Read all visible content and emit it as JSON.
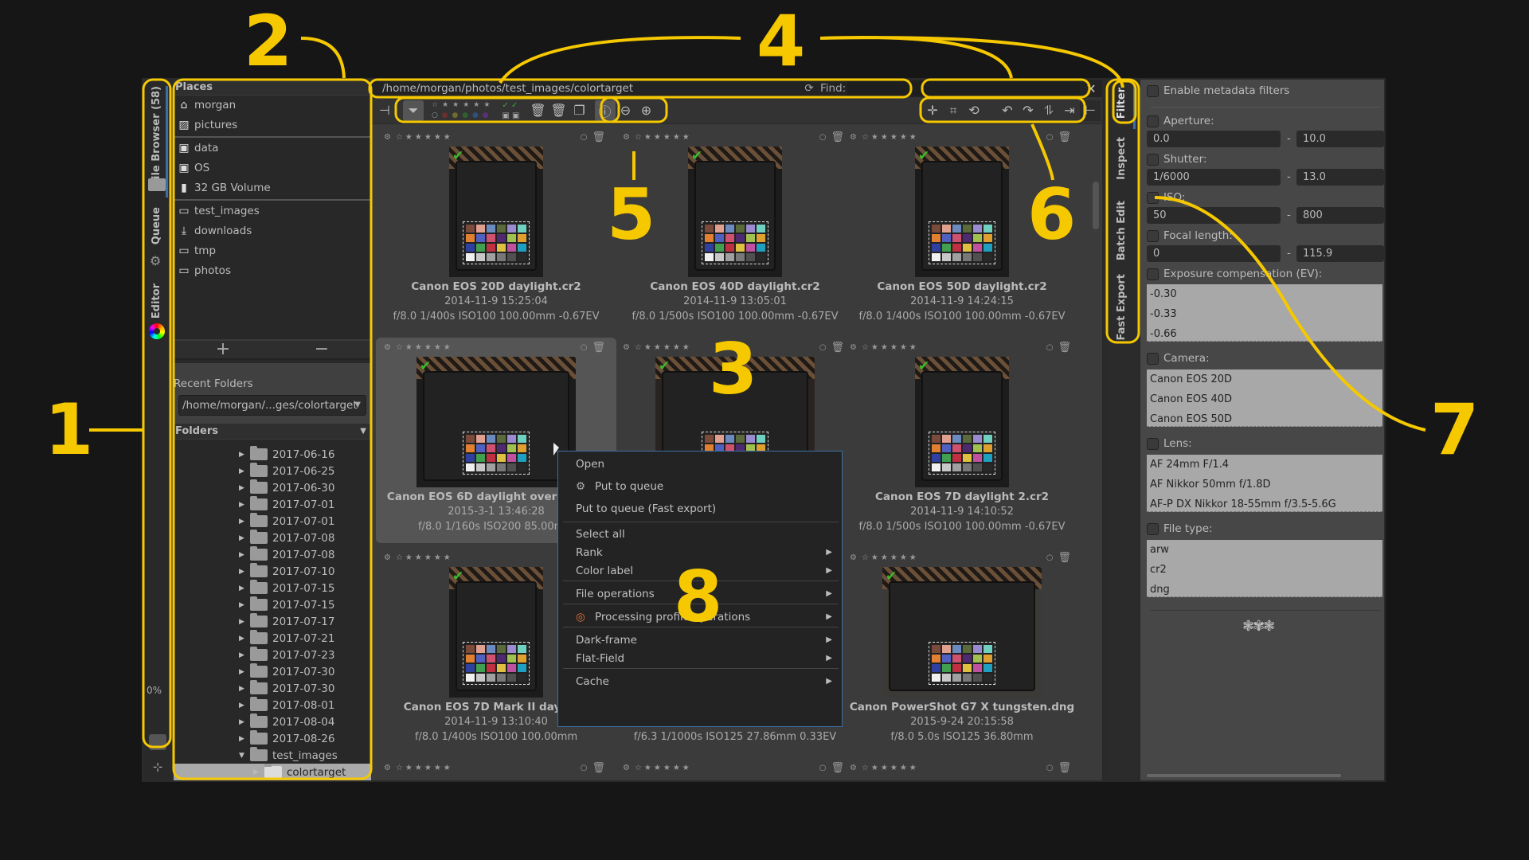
{
  "left_tabs": {
    "file_browser": "File Browser (58)",
    "queue": "Queue",
    "editor": "Editor",
    "progress": "0%"
  },
  "places": {
    "header": "Places",
    "items": [
      {
        "label": "morgan",
        "icon": "home-icon"
      },
      {
        "label": "pictures",
        "icon": "image-icon"
      },
      {
        "label": "data",
        "icon": "drive-icon"
      },
      {
        "label": "OS",
        "icon": "drive-icon"
      },
      {
        "label": "32 GB Volume",
        "icon": "usb-icon"
      },
      {
        "label": "test_images",
        "icon": "folder-icon"
      },
      {
        "label": "downloads",
        "icon": "download-icon"
      },
      {
        "label": "tmp",
        "icon": "folder-icon"
      },
      {
        "label": "photos",
        "icon": "folder-icon"
      }
    ],
    "add_label": "+",
    "remove_label": "−",
    "recent_header": "Recent Folders",
    "recent_value": "/home/morgan/...ges/colortarget",
    "folders_header": "Folders",
    "folders": [
      "2017-06-16",
      "2017-06-25",
      "2017-06-30",
      "2017-07-01",
      "2017-07-01",
      "2017-07-08",
      "2017-07-08",
      "2017-07-10",
      "2017-07-15",
      "2017-07-15",
      "2017-07-17",
      "2017-07-21",
      "2017-07-23",
      "2017-07-30",
      "2017-07-30",
      "2017-08-01",
      "2017-08-04",
      "2017-08-26"
    ],
    "open_folder": "test_images",
    "selected_folder": "colortarget"
  },
  "browser": {
    "path": "/home/morgan/photos/test_images/colortarget",
    "find_label": "Find:",
    "find_value": "",
    "thumbnails": [
      {
        "name": "Canon EOS 20D daylight.cr2",
        "date": "2014-11-9 15:25:04",
        "exif": "f/8.0 1/400s ISO100 100.00mm -0.67EV",
        "selected": false
      },
      {
        "name": "Canon EOS 40D daylight.cr2",
        "date": "2014-11-9 13:05:01",
        "exif": "f/8.0 1/500s ISO100 100.00mm -0.67EV",
        "selected": false
      },
      {
        "name": "Canon EOS 50D daylight.cr2",
        "date": "2014-11-9 14:24:15",
        "exif": "f/8.0 1/400s ISO100 100.00mm -0.67EV",
        "selected": false
      },
      {
        "name": "Canon EOS 6D daylight overcast.cr2",
        "date": "2015-3-1 13:46:28",
        "exif": "f/8.0 1/160s ISO200 85.00mm",
        "selected": true
      },
      {
        "name": "",
        "date": "",
        "exif": "",
        "selected": false
      },
      {
        "name": "Canon EOS 7D daylight 2.cr2",
        "date": "2014-11-9 14:10:52",
        "exif": "f/8.0 1/500s ISO100 100.00mm -0.67EV",
        "selected": false
      },
      {
        "name": "Canon EOS 7D Mark II daylight",
        "date": "2014-11-9 13:10:40",
        "exif": "f/8.0 1/400s ISO100 100.00mm",
        "selected": false
      },
      {
        "name": "",
        "date": "",
        "exif": "f/6.3 1/1000s ISO125 27.86mm 0.33EV",
        "selected": false
      },
      {
        "name": "Canon PowerShot G7 X tungsten.dng",
        "date": "2015-9-24 20:15:58",
        "exif": "f/8.0 5.0s ISO125 36.80mm",
        "selected": false
      }
    ]
  },
  "context_menu": {
    "items": [
      {
        "label": "Open",
        "submenu": false
      },
      {
        "label": "Put to queue",
        "submenu": false,
        "icon": "gears-icon"
      },
      {
        "label": "Put to queue (Fast export)",
        "submenu": false
      },
      {
        "label": "Select all",
        "submenu": false
      },
      {
        "label": "Rank",
        "submenu": true
      },
      {
        "label": "Color label",
        "submenu": true
      },
      {
        "label": "File operations",
        "submenu": true
      },
      {
        "label": "Processing profile operations",
        "submenu": true,
        "icon": "profile-icon"
      },
      {
        "label": "Dark-frame",
        "submenu": true
      },
      {
        "label": "Flat-Field",
        "submenu": true
      },
      {
        "label": "Cache",
        "submenu": true
      }
    ]
  },
  "right_tabs": [
    "Filter",
    "Inspect",
    "Batch Edit",
    "Fast Export"
  ],
  "filter": {
    "enable_label": "Enable metadata filters",
    "aperture": {
      "label": "Aperture:",
      "from": "0.0",
      "to": "10.0"
    },
    "shutter": {
      "label": "Shutter:",
      "from": "1/6000",
      "to": "13.0"
    },
    "iso": {
      "label": "ISO:",
      "from": "50",
      "to": "800"
    },
    "focal": {
      "label": "Focal length:",
      "from": "0",
      "to": "115.9"
    },
    "range_sep": "-",
    "exposure": {
      "label": "Exposure compensation (EV):",
      "values": [
        "-0.30",
        "-0.33",
        "-0.66"
      ]
    },
    "camera": {
      "label": "Camera:",
      "values": [
        "Canon EOS 20D",
        "Canon EOS 40D",
        "Canon EOS 50D"
      ]
    },
    "lens": {
      "label": "Lens:",
      "values": [
        "AF 24mm F/1.4",
        "AF Nikkor 50mm f/1.8D",
        "AF-P DX Nikkor 18-55mm f/3.5-5.6G"
      ]
    },
    "filetype": {
      "label": "File type:",
      "values": [
        "arw",
        "cr2",
        "dng"
      ]
    }
  },
  "annotations": [
    "1",
    "2",
    "3",
    "4",
    "5",
    "6",
    "7",
    "8"
  ],
  "colors": {
    "accent": "#f5c800",
    "check_green": "#3cbb2a",
    "menu_border": "#3b6fa8"
  }
}
